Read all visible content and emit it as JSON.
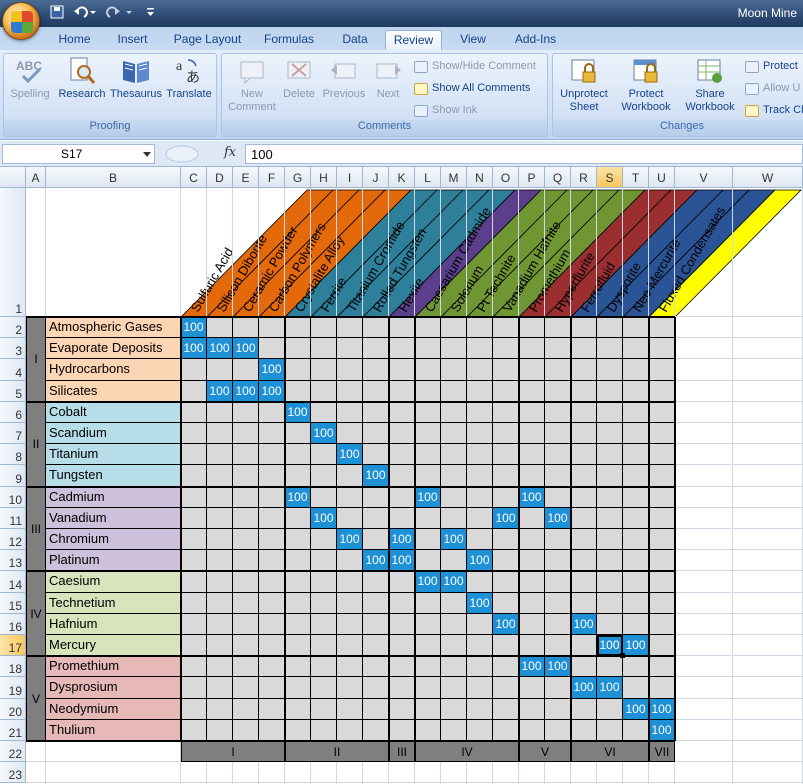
{
  "app": {
    "title": "Moon Mine",
    "qat": [
      "save-icon",
      "undo-icon",
      "redo-icon",
      "customize-icon"
    ]
  },
  "tabs": [
    "Home",
    "Insert",
    "Page Layout",
    "Formulas",
    "Data",
    "Review",
    "View",
    "Add-Ins"
  ],
  "active_tab": "Review",
  "ribbon": {
    "proofing": {
      "label": "Proofing",
      "buttons": [
        "Spelling",
        "Research",
        "Thesaurus",
        "Translate"
      ]
    },
    "comments": {
      "label": "Comments",
      "new": "New Comment",
      "delete": "Delete",
      "previous": "Previous",
      "next": "Next",
      "show_hide": "Show/Hide Comment",
      "show_all": "Show All Comments",
      "show_ink": "Show Ink"
    },
    "changes": {
      "label": "Changes",
      "unprotect_sheet": "Unprotect Sheet",
      "protect_workbook": "Protect Workbook",
      "share_workbook": "Share Workbook",
      "protect_share": "Protect",
      "allow_users": "Allow U",
      "track_changes": "Track Ch"
    }
  },
  "formula_bar": {
    "name_box": "S17",
    "fx": "fx",
    "formula": "100"
  },
  "columns": [
    "A",
    "B",
    "C",
    "D",
    "E",
    "F",
    "G",
    "H",
    "I",
    "J",
    "K",
    "L",
    "M",
    "N",
    "O",
    "P",
    "Q",
    "R",
    "S",
    "T",
    "U",
    "V",
    "W"
  ],
  "selected_column": "S",
  "rows": [
    "1",
    "2",
    "3",
    "4",
    "5",
    "6",
    "7",
    "8",
    "9",
    "10",
    "11",
    "12",
    "13",
    "14",
    "15",
    "16",
    "17",
    "18",
    "19",
    "20",
    "21",
    "22",
    "23"
  ],
  "selected_row": "17",
  "products": [
    "Sulfuric Acid",
    "Silicon Diborite",
    "Ceramic Powder",
    "Carbon Polymers",
    "Crystalite Alloy",
    "Ferrite",
    "Titanium Cromide",
    "Rolled Tungsten",
    "Hexite",
    "Caesarium Cadmide",
    "Solerium",
    "Pt Technite",
    "Vanadium Hafnite",
    "Promethium",
    "Hyperflurite",
    "Ferrofluid",
    "Dysporite",
    "Neo Mercurite",
    "Fluxed Condensates"
  ],
  "product_colors": [
    "#e3690b",
    "#e3690b",
    "#e3690b",
    "#e3690b",
    "#2d7f9a",
    "#2d7f9a",
    "#2d7f9a",
    "#2d7f9a",
    "#5b3f8c",
    "#6f9632",
    "#6f9632",
    "#6f9632",
    "#6f9632",
    "#9b2f2f",
    "#9b2f2f",
    "#2b5497",
    "#2b5497",
    "#2b5497",
    "#ffff00"
  ],
  "materials": [
    {
      "name": "Atmospheric Gases",
      "color": "#fcd5b4"
    },
    {
      "name": "Evaporate Deposits",
      "color": "#fcd5b4"
    },
    {
      "name": "Hydrocarbons",
      "color": "#fcd5b4"
    },
    {
      "name": "Silicates",
      "color": "#fcd5b4"
    },
    {
      "name": "Cobalt",
      "color": "#b7dde8"
    },
    {
      "name": "Scandium",
      "color": "#b7dde8"
    },
    {
      "name": "Titanium",
      "color": "#b7dde8"
    },
    {
      "name": "Tungsten",
      "color": "#b7dde8"
    },
    {
      "name": "Cadmium",
      "color": "#ccc0da"
    },
    {
      "name": "Vanadium",
      "color": "#ccc0da"
    },
    {
      "name": "Chromium",
      "color": "#ccc0da"
    },
    {
      "name": "Platinum",
      "color": "#ccc0da"
    },
    {
      "name": "Caesium",
      "color": "#d7e4bc"
    },
    {
      "name": "Technetium",
      "color": "#d7e4bc"
    },
    {
      "name": "Hafnium",
      "color": "#d7e4bc"
    },
    {
      "name": "Mercury",
      "color": "#d7e4bc"
    },
    {
      "name": "Promethium",
      "color": "#e6b9b8"
    },
    {
      "name": "Dysprosium",
      "color": "#e6b9b8"
    },
    {
      "name": "Neodymium",
      "color": "#e6b9b8"
    },
    {
      "name": "Thulium",
      "color": "#e6b9b8"
    }
  ],
  "row_groups": [
    "I",
    "II",
    "III",
    "IV",
    "V"
  ],
  "col_groups": [
    "I",
    "II",
    "III",
    "IV",
    "V",
    "VI",
    "VII"
  ],
  "cell_value": "100",
  "matrix": [
    [
      0
    ],
    [
      0,
      1,
      2
    ],
    [
      3
    ],
    [
      1,
      2,
      3
    ],
    [
      4
    ],
    [
      5
    ],
    [
      6
    ],
    [
      7
    ],
    [
      4,
      9,
      13
    ],
    [
      5,
      12,
      14
    ],
    [
      6,
      8,
      10
    ],
    [
      7,
      8,
      11
    ],
    [
      9,
      10
    ],
    [
      11
    ],
    [
      12,
      15
    ],
    [
      16,
      17
    ],
    [
      13,
      14
    ],
    [
      15,
      16
    ],
    [
      17,
      18
    ],
    [
      18
    ]
  ]
}
